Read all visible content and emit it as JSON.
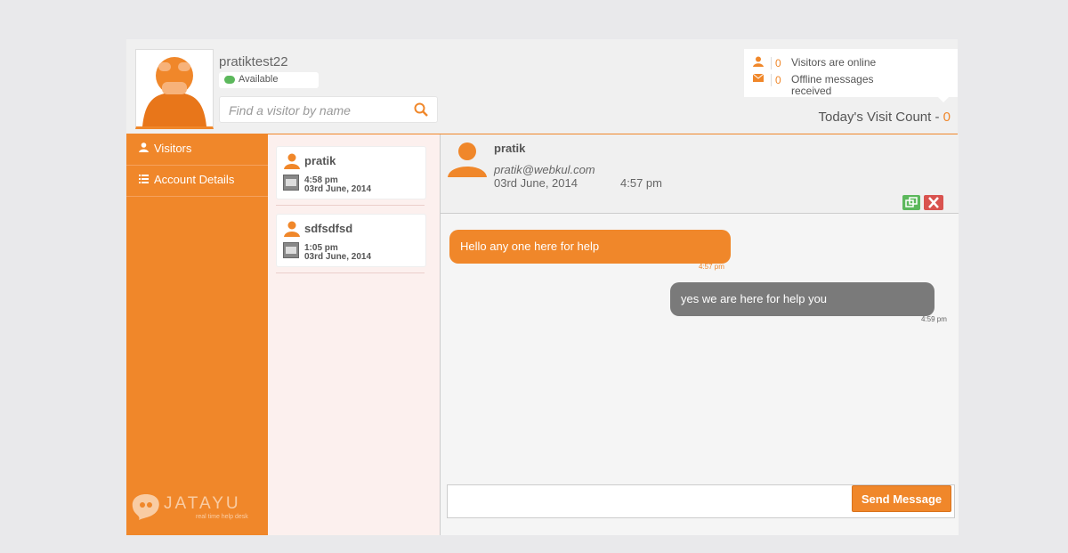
{
  "header": {
    "username": "pratiktest22",
    "status": "Available",
    "search_placeholder": "Find a visitor by name",
    "online_count": "0",
    "online_label": "Visitors are online",
    "offline_count": "0",
    "offline_label": "Offline messages received",
    "visit_label": "Today's Visit Count - ",
    "visit_count": "0"
  },
  "sidebar": {
    "items": [
      {
        "label": "Visitors",
        "icon": "user-icon"
      },
      {
        "label": "Account Details",
        "icon": "list-icon"
      }
    ],
    "logo_word": "JATAYU",
    "logo_tagline": "real time help desk"
  },
  "visitors": [
    {
      "name": "pratik",
      "time": "4:58 pm",
      "date": "03rd June, 2014"
    },
    {
      "name": "sdfsdfsd",
      "time": "1:05 pm",
      "date": "03rd June, 2014"
    }
  ],
  "chat": {
    "name": "pratik",
    "email": "pratik@webkul.com",
    "date": "03rd June, 2014",
    "time": "4:57 pm",
    "messages": [
      {
        "text": "Hello any one here for help",
        "time": "4:57 pm",
        "from": "visitor"
      },
      {
        "text": "yes we are here for help you",
        "time": "4:59 pm",
        "from": "agent"
      }
    ],
    "send_label": "Send Message"
  },
  "colors": {
    "accent": "#f0872a",
    "agent_bubble": "#7a7a7a",
    "success": "#5cb85c",
    "danger": "#d9534f"
  }
}
